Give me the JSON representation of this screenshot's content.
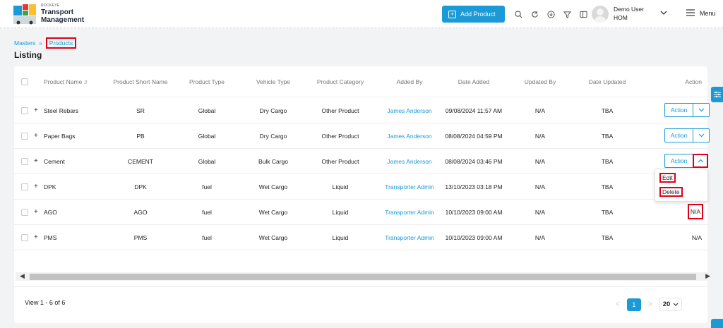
{
  "brand": {
    "small": "ROCKEYE",
    "line1": "Transport",
    "line2": "Management"
  },
  "header": {
    "add_label": "Add Product",
    "icons": [
      "search-icon",
      "refresh-icon",
      "download-icon",
      "filter-icon",
      "columns-icon"
    ],
    "user_name": "Demo User",
    "user_role": "HOM",
    "menu_label": "Menu"
  },
  "breadcrumb": {
    "parent": "Masters",
    "separator": "»",
    "current": "Products"
  },
  "page_title": "Listing",
  "table": {
    "columns": [
      "Product Name",
      "Product Short Name",
      "Product Type",
      "Vehicle Type",
      "Product Category",
      "Added By",
      "Date Added",
      "Updated By",
      "Date Updated",
      "Action"
    ],
    "sort_symbol": "⇵",
    "rows": [
      {
        "name": "Steel Rebars",
        "short": "SR",
        "type": "Global",
        "vehicle": "Dry Cargo",
        "category": "Other Product",
        "added_by": "James Anderson",
        "date_added": "09/08/2024 11:57 AM",
        "updated_by": "N/A",
        "date_updated": "TBA",
        "action": "Action"
      },
      {
        "name": "Paper Bags",
        "short": "PB",
        "type": "Global",
        "vehicle": "Dry Cargo",
        "category": "Other Product",
        "added_by": "James Anderson",
        "date_added": "08/08/2024 04:59 PM",
        "updated_by": "N/A",
        "date_updated": "TBA",
        "action": "Action"
      },
      {
        "name": "Cement",
        "short": "CEMENT",
        "type": "Global",
        "vehicle": "Bulk Cargo",
        "category": "Other Product",
        "added_by": "James Anderson",
        "date_added": "08/08/2024 03:46 PM",
        "updated_by": "N/A",
        "date_updated": "TBA",
        "action": "Action"
      },
      {
        "name": "DPK",
        "short": "DPK",
        "type": "fuel",
        "vehicle": "Wet Cargo",
        "category": "Liquid",
        "added_by": "Transporter Admin",
        "date_added": "13/10/2023 03:18 PM",
        "updated_by": "N/A",
        "date_updated": "TBA",
        "action": ""
      },
      {
        "name": "AGO",
        "short": "AGO",
        "type": "fuel",
        "vehicle": "Wet Cargo",
        "category": "Liquid",
        "added_by": "Transporter Admin",
        "date_added": "10/10/2023 09:00 AM",
        "updated_by": "N/A",
        "date_updated": "TBA",
        "action": "N/A"
      },
      {
        "name": "PMS",
        "short": "PMS",
        "type": "fuel",
        "vehicle": "Wet Cargo",
        "category": "Liquid",
        "added_by": "Transporter Admin",
        "date_added": "10/10/2023 09:00 AM",
        "updated_by": "N/A",
        "date_updated": "TBA",
        "action": "N/A"
      }
    ]
  },
  "action_menu": {
    "edit": "Edit",
    "delete": "Delete"
  },
  "footer": {
    "view_count": "View 1 - 6 of 6",
    "current_page": "1",
    "page_size": "20"
  },
  "colors": {
    "accent": "#1a9ad6",
    "highlight": "#e0001b"
  }
}
